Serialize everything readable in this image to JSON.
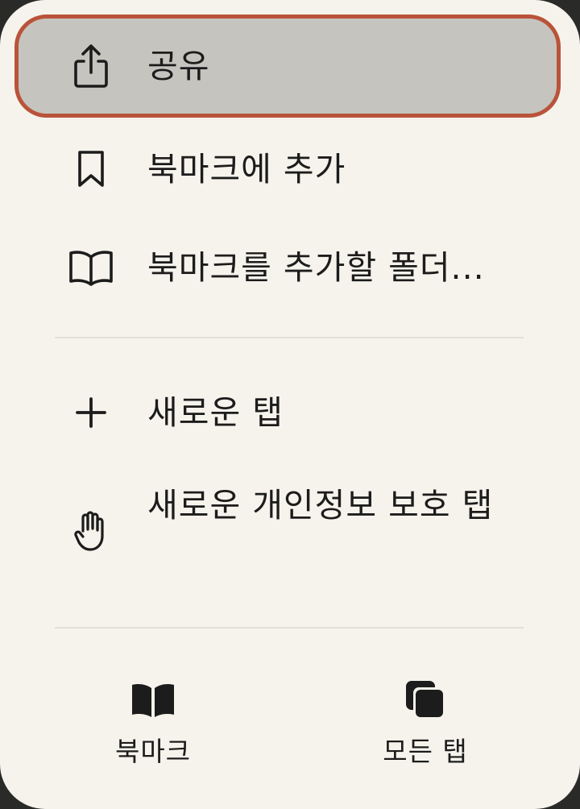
{
  "menu": {
    "items": [
      {
        "label": "공유",
        "icon": "share-icon",
        "highlighted": true
      },
      {
        "label": "북마크에 추가",
        "icon": "bookmark-icon"
      },
      {
        "label": "북마크를 추가할 폴더...",
        "icon": "book-open-icon"
      },
      {
        "label": "새로운 탭",
        "icon": "plus-icon"
      },
      {
        "label": "새로운 개인정보 보호 탭",
        "icon": "hand-icon"
      }
    ],
    "bottom": [
      {
        "label": "북마크",
        "icon": "book-filled-icon"
      },
      {
        "label": "모든 탭",
        "icon": "tabs-stack-icon"
      }
    ]
  },
  "colors": {
    "background": "#f6f3ec",
    "highlight": "#c6c4bf",
    "highlight_border": "#b9533a",
    "text": "#1c1c1c"
  }
}
